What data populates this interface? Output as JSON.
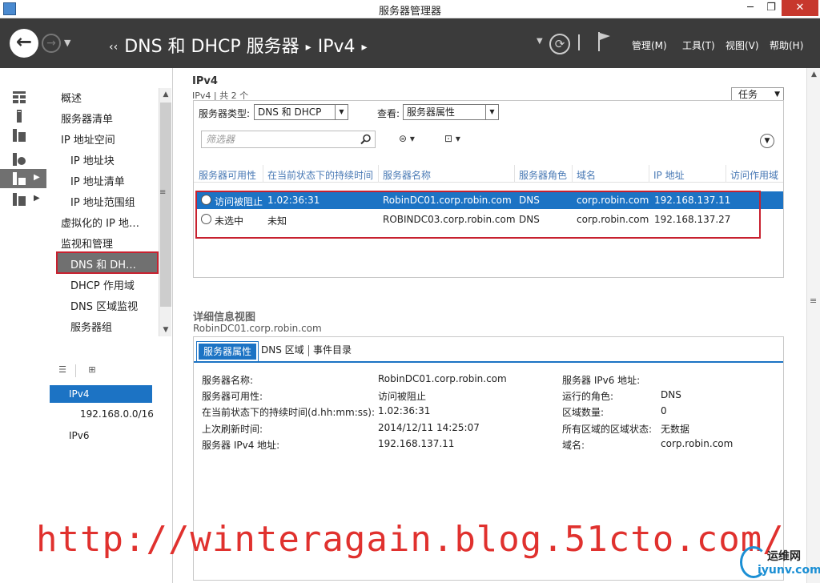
{
  "window": {
    "title": "服务器管理器",
    "controls": {
      "minimize": "─",
      "maximize": "❐",
      "close": "✕"
    }
  },
  "nav": {
    "breadcrumb": [
      "DNS 和 DHCP 服务器",
      "IPv4"
    ],
    "breadcrumb_prefix": "‹‹",
    "menus": {
      "manage": "管理(M)",
      "tools": "工具(T)",
      "view": "视图(V)",
      "help": "帮助(H)"
    }
  },
  "tree": {
    "items": [
      "概述",
      "服务器清单",
      "IP 地址空间",
      "IP 地址块",
      "IP 地址清单",
      "IP 地址范围组",
      "虚拟化的 IP 地…",
      "监视和管理",
      "DNS 和 DH…",
      "DHCP 作用域",
      "DNS 区域监视",
      "服务器组"
    ],
    "ip_nodes": [
      "IPv4",
      "192.168.0.0/16",
      "IPv6"
    ]
  },
  "main": {
    "title": "IPv4",
    "subtitle": "IPv4 | 共 2 个",
    "tasks_label": "任务",
    "server_type_label": "服务器类型:",
    "server_type_value": "DNS 和 DHCP",
    "view_label": "查看:",
    "view_value": "服务器属性",
    "filter_placeholder": "筛选器",
    "columns": [
      "服务器可用性",
      "在当前状态下的持续时间",
      "服务器名称",
      "服务器角色",
      "域名",
      "IP 地址",
      "访问作用域"
    ],
    "rows": [
      {
        "availability": "访问被阻止",
        "duration": "1.02:36:31",
        "name": "RobinDC01.corp.robin.com",
        "role": "DNS",
        "domain": "corp.robin.com",
        "ip": "192.168.137.11",
        "selected": true
      },
      {
        "availability": "未选中",
        "duration": "未知",
        "name": "ROBINDC03.corp.robin.com",
        "role": "DNS",
        "domain": "corp.robin.com",
        "ip": "192.168.137.27",
        "selected": false
      }
    ]
  },
  "details": {
    "title": "详细信息视图",
    "subtitle": "RobinDC01.corp.robin.com",
    "tabs": [
      "服务器属性",
      "DNS 区域",
      "事件目录"
    ],
    "left": [
      {
        "label": "服务器名称:",
        "value": "RobinDC01.corp.robin.com"
      },
      {
        "label": "服务器可用性:",
        "value": "访问被阻止"
      },
      {
        "label": "在当前状态下的持续时间(d.hh:mm:ss):",
        "value": "1.02:36:31"
      },
      {
        "label": "上次刷新时间:",
        "value": "2014/12/11 14:25:07"
      },
      {
        "label": "服务器 IPv4 地址:",
        "value": "192.168.137.11"
      }
    ],
    "right": [
      {
        "label": "服务器 IPv6 地址:",
        "value": ""
      },
      {
        "label": "运行的角色:",
        "value": "DNS"
      },
      {
        "label": "区域数量:",
        "value": "0"
      },
      {
        "label": "所有区域的区域状态:",
        "value": "无数据"
      },
      {
        "label": "域名:",
        "value": "corp.robin.com"
      }
    ]
  },
  "watermark": {
    "url": "http://winteragain.blog.51cto.com/",
    "logo_cn": "运维网",
    "logo_en": "iyunv.com"
  },
  "colors": {
    "accent": "#1c73c4",
    "highlight_red": "#c8212f",
    "nav_bg": "#3b3b3b"
  }
}
